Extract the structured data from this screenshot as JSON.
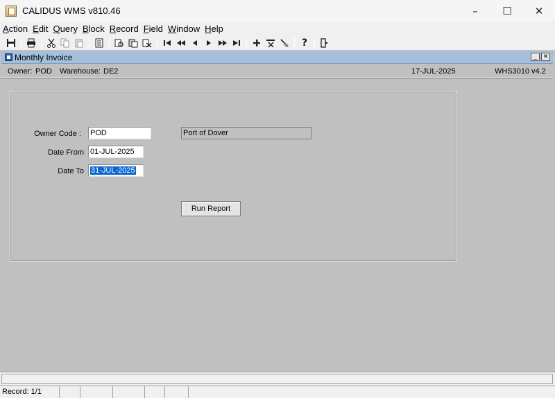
{
  "window": {
    "title": "CALIDUS WMS v810.46"
  },
  "menu": [
    {
      "label": "Action",
      "u": "A",
      "rest": "ction"
    },
    {
      "label": "Edit",
      "u": "E",
      "rest": "dit"
    },
    {
      "label": "Query",
      "u": "Q",
      "rest": "uery"
    },
    {
      "label": "Block",
      "u": "B",
      "rest": "lock"
    },
    {
      "label": "Record",
      "u": "R",
      "rest": "ecord"
    },
    {
      "label": "Field",
      "u": "F",
      "rest": "ield"
    },
    {
      "label": "Window",
      "u": "W",
      "rest": "indow"
    },
    {
      "label": "Help",
      "u": "H",
      "rest": "elp"
    }
  ],
  "form": {
    "title": "Monthly Invoice",
    "owner_label": "Owner:",
    "owner_value": "POD",
    "warehouse_label": "Warehouse:",
    "warehouse_value": "DE2",
    "date": "17-JUL-2025",
    "program": "WHS3010",
    "version": "v4.2"
  },
  "fields": {
    "owner_code_label": "Owner Code :",
    "owner_code_value": "POD",
    "owner_name": "Port of Dover",
    "date_from_label": "Date From",
    "date_from_value": "01-JUL-2025",
    "date_to_label": "Date To",
    "date_to_value": "31-JUL-2025"
  },
  "buttons": {
    "run_report": "Run Report"
  },
  "status": {
    "record": "Record: 1/1"
  }
}
